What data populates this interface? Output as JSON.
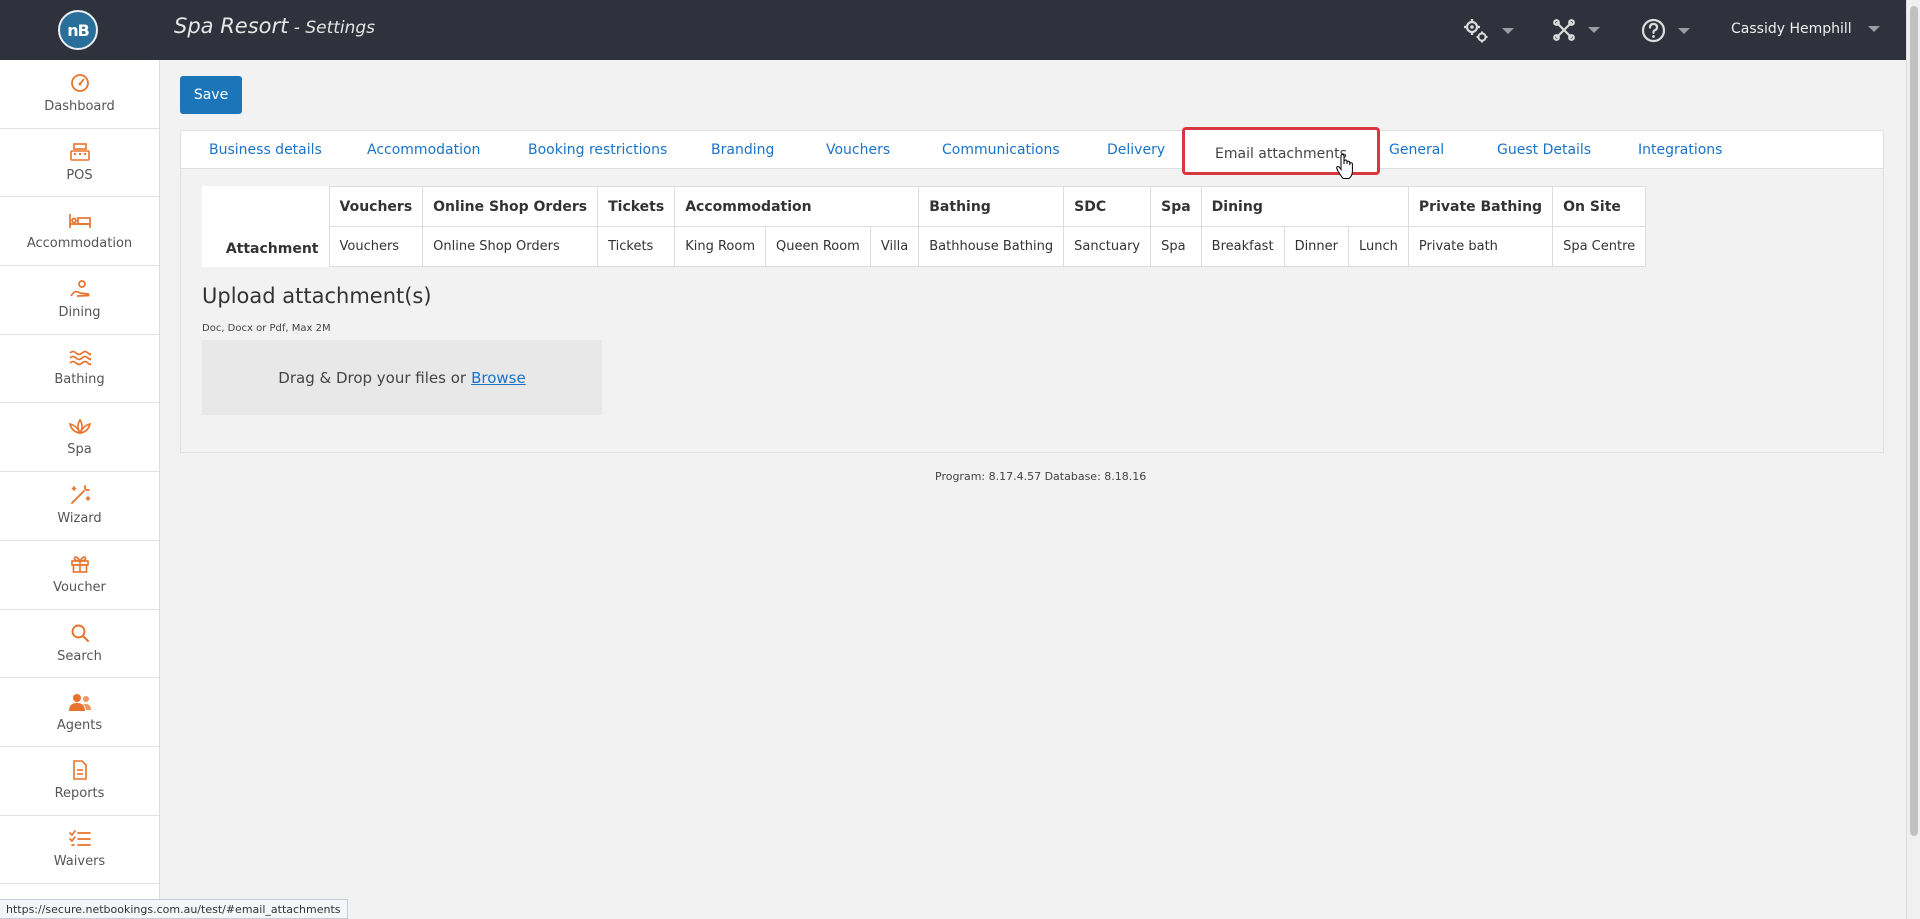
{
  "header": {
    "logo_text": "nB",
    "title": "Spa Resort",
    "subtitle": " - Settings",
    "user_name": "Cassidy Hemphill"
  },
  "colors": {
    "topbar": "#2f323c",
    "accent": "#1c75b9",
    "nav_icon": "#e8732c",
    "tab_highlight": "#d9373f"
  },
  "actions": {
    "save_label": "Save"
  },
  "sidebar": {
    "items": [
      {
        "label": "Dashboard",
        "icon": "gauge-icon"
      },
      {
        "label": "POS",
        "icon": "cash-register-icon"
      },
      {
        "label": "Accommodation",
        "icon": "bed-icon"
      },
      {
        "label": "Dining",
        "icon": "dining-icon"
      },
      {
        "label": "Bathing",
        "icon": "water-waves-icon"
      },
      {
        "label": "Spa",
        "icon": "lotus-icon"
      },
      {
        "label": "Wizard",
        "icon": "magic-wand-icon"
      },
      {
        "label": "Voucher",
        "icon": "gift-icon"
      },
      {
        "label": "Search",
        "icon": "search-icon"
      },
      {
        "label": "Agents",
        "icon": "users-icon"
      },
      {
        "label": "Reports",
        "icon": "document-icon"
      },
      {
        "label": "Waivers",
        "icon": "checklist-icon"
      }
    ]
  },
  "tabs": [
    "Business details",
    "Accommodation",
    "Booking restrictions",
    "Branding",
    "Vouchers",
    "Communications",
    "Delivery",
    "Email attachments",
    "General",
    "Guest Details",
    "Integrations"
  ],
  "active_tab": "Email attachments",
  "attachments_table": {
    "row_header": "Attachment",
    "groups": [
      {
        "name": "Vouchers",
        "items": [
          "Vouchers"
        ]
      },
      {
        "name": "Online Shop Orders",
        "items": [
          "Online Shop Orders"
        ]
      },
      {
        "name": "Tickets",
        "items": [
          "Tickets"
        ]
      },
      {
        "name": "Accommodation",
        "items": [
          "King Room",
          "Queen Room",
          "Villa"
        ]
      },
      {
        "name": "Bathing",
        "items": [
          "Bathhouse Bathing"
        ]
      },
      {
        "name": "SDC",
        "items": [
          "Sanctuary"
        ]
      },
      {
        "name": "Spa",
        "items": [
          "Spa"
        ]
      },
      {
        "name": "Dining",
        "items": [
          "Breakfast",
          "Dinner",
          "Lunch"
        ]
      },
      {
        "name": "Private Bathing",
        "items": [
          "Private bath"
        ]
      },
      {
        "name": "On Site",
        "items": [
          "Spa Centre"
        ]
      }
    ]
  },
  "upload": {
    "title": "Upload attachment(s)",
    "hint": "Doc, Docx or Pdf, Max 2M",
    "drop_text": "Drag & Drop your files or",
    "browse_label": "Browse"
  },
  "footer": {
    "version": "Program: 8.17.4.57 Database: 8.18.16"
  },
  "status_bar": {
    "url": "https://secure.netbookings.com.au/test/#email_attachments"
  }
}
